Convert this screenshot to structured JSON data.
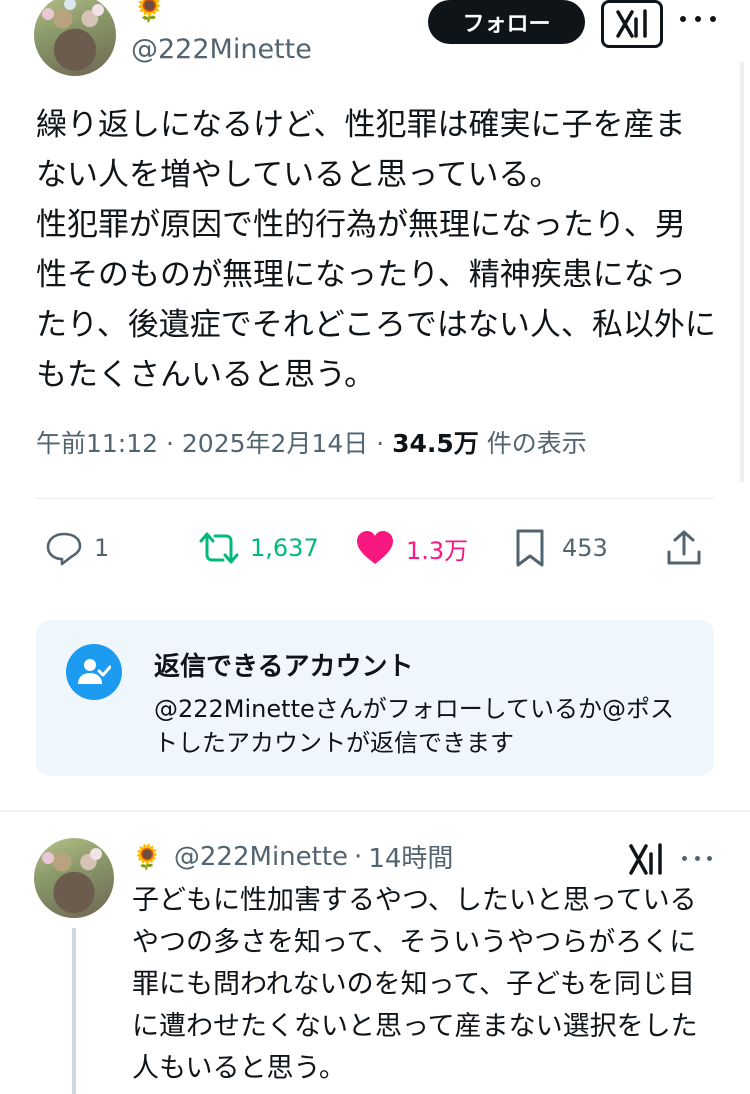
{
  "post": {
    "author_emoji": "🌻",
    "handle": "@222Minette",
    "follow_label": "フォロー",
    "text": "繰り返しになるけど、性犯罪は確実に子を産まない人を増やしていると思っている。\n性犯罪が原因で性的行為が無理になったり、男性そのものが無理になったり、精神疾患になったり、後遺症でそれどころではない人、私以外にもたくさんいると思う。",
    "time": "午前11:12",
    "date": "2025年2月14日",
    "separator": "·",
    "views_count": "34.5万",
    "views_label": "件の表示"
  },
  "actions": {
    "reply_count": "1",
    "repost_count": "1,637",
    "like_count": "1.3万",
    "bookmark_count": "453"
  },
  "restriction": {
    "title": "返信できるアカウント",
    "description": "@222Minetteさんがフォローしているか@ポストしたアカウントが返信できます"
  },
  "reply": {
    "author_emoji": "🌻",
    "handle": "@222Minette",
    "separator": "·",
    "time": "14時間",
    "text": "子どもに性加害するやつ、したいと思っているやつの多さを知って、そういうやつらがろくに罪にも問われないのを知って、子どもを同じ目に遭わせたくないと思って産まない選択をした人もいると思う。"
  },
  "colors": {
    "text": "#0f1419",
    "secondary": "#536471",
    "repost": "#00ba7c",
    "like": "#f91880",
    "accent": "#1d9bf0",
    "card_bg": "#eff7fd"
  }
}
